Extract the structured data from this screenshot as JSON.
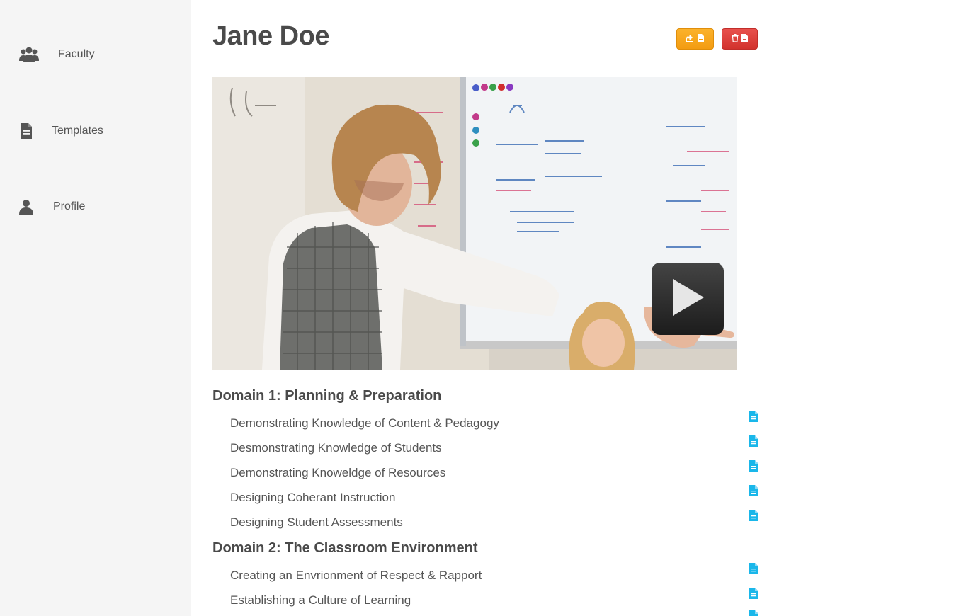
{
  "sidebar": {
    "items": [
      {
        "label": "Faculty",
        "icon": "users-icon"
      },
      {
        "label": "Templates",
        "icon": "document-icon"
      },
      {
        "label": "Profile",
        "icon": "user-icon"
      }
    ]
  },
  "header": {
    "title": "Jane Doe",
    "actions": [
      {
        "icon": "share-document-icon",
        "color": "#f39c12"
      },
      {
        "icon": "trash-document-icon",
        "color": "#d9534f"
      }
    ]
  },
  "video": {
    "thumbnail": "classroom teacher pointing at whiteboard",
    "play_icon": "play-icon"
  },
  "domains": [
    {
      "title": "Domain 1: Planning & Preparation",
      "items": [
        "Demonstrating Knowledge of Content & Pedagogy",
        "Desmonstrating Knowledge of Students",
        "Demonstrating Knoweldge of Resources",
        "Designing Coherant Instruction",
        "Designing Student Assessments"
      ]
    },
    {
      "title": "Domain 2: The Classroom Environment",
      "items": [
        "Creating an Envrionment of Respect & Rapport",
        "Establishing a Culture of Learning"
      ]
    }
  ],
  "colors": {
    "sidebar_bg": "#f5f5f5",
    "accent_icon": "#1ab7ea",
    "share_button": "#f39c12",
    "delete_button": "#d9534f"
  }
}
